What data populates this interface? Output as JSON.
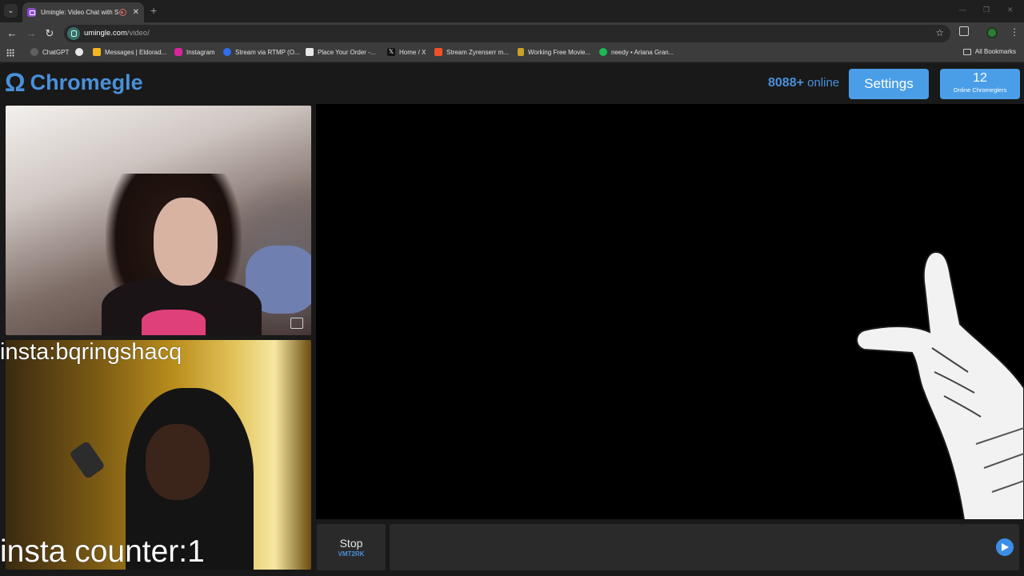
{
  "browser": {
    "tab": {
      "title": "Umingle: Video Chat with Stran"
    },
    "new_tab_symbol": "+",
    "url": {
      "host": "umingle.com",
      "path": "/video/"
    },
    "bookmarks": [
      {
        "label": "ChatGPT",
        "color": "#5f5f5f"
      },
      {
        "label": "",
        "color": "#e8e8e8"
      },
      {
        "label": "Messages | Eldorad...",
        "color": "#f3b61f"
      },
      {
        "label": "Instagram",
        "color": "#d6249f"
      },
      {
        "label": "Stream via RTMP (O...",
        "color": "#2f6fed"
      },
      {
        "label": "Place Your Order -...",
        "color": "#e8e8e8"
      },
      {
        "label": "Home / X",
        "color": "#111111"
      },
      {
        "label": "Stream Zyrenserr m...",
        "color": "#f0502a"
      },
      {
        "label": "Working Free Movie...",
        "color": "#c9a227"
      },
      {
        "label": "needy • Ariana Gran...",
        "color": "#1db954"
      }
    ],
    "all_bookmarks": "All Bookmarks"
  },
  "site": {
    "logo_symbol": "Ω",
    "logo_text": "Chromegle",
    "online_count": "8088+",
    "online_label": "online",
    "settings_label": "Settings",
    "chromeglers_count": "12",
    "chromeglers_label": "Online Chromeglers"
  },
  "overlays": {
    "insta_tag": "insta:bqringshacq",
    "counter": "insta counter:1"
  },
  "controls": {
    "stop_label": "Stop",
    "stop_code": "VMT2RK",
    "chat_placeholder": ""
  },
  "colors": {
    "accent": "#4a90d9",
    "button": "#4a9ee8"
  }
}
